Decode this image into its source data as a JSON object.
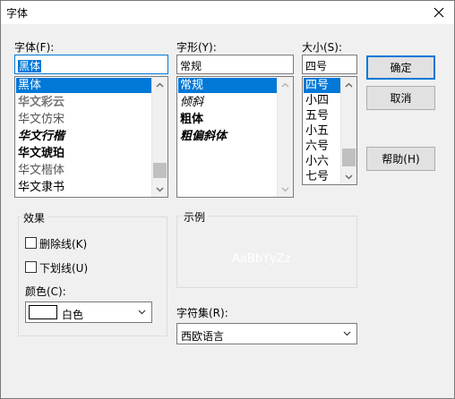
{
  "window": {
    "title": "字体",
    "close_icon": "close-icon"
  },
  "font": {
    "label": "字体(F):",
    "value": "黑体",
    "items": [
      "黑体",
      "华文彩云",
      "华文仿宋",
      "华文行楷",
      "华文琥珀",
      "华文楷体",
      "华文隶书"
    ],
    "selected_index": 0
  },
  "style": {
    "label": "字形(Y):",
    "value": "常规",
    "items": [
      "常规",
      "倾斜",
      "粗体",
      "粗偏斜体"
    ],
    "selected_index": 0
  },
  "size": {
    "label": "大小(S):",
    "value": "四号",
    "items": [
      "四号",
      "小四",
      "五号",
      "小五",
      "六号",
      "小六",
      "七号"
    ],
    "selected_index": 0
  },
  "buttons": {
    "ok": "确定",
    "cancel": "取消",
    "help": "帮助(H)"
  },
  "effects": {
    "label": "效果",
    "strikeout": {
      "label": "删除线(K)",
      "checked": false
    },
    "underline": {
      "label": "下划线(U)",
      "checked": false
    },
    "color_label": "颜色(C):",
    "color_value": "白色",
    "color_swatch": "#ffffff"
  },
  "sample": {
    "label": "示例",
    "text": "AaBbYyZz"
  },
  "script": {
    "label": "字符集(R):",
    "value": "西欧语言"
  },
  "colors": {
    "accent": "#0078d7",
    "selection_text": "#ffffff"
  }
}
